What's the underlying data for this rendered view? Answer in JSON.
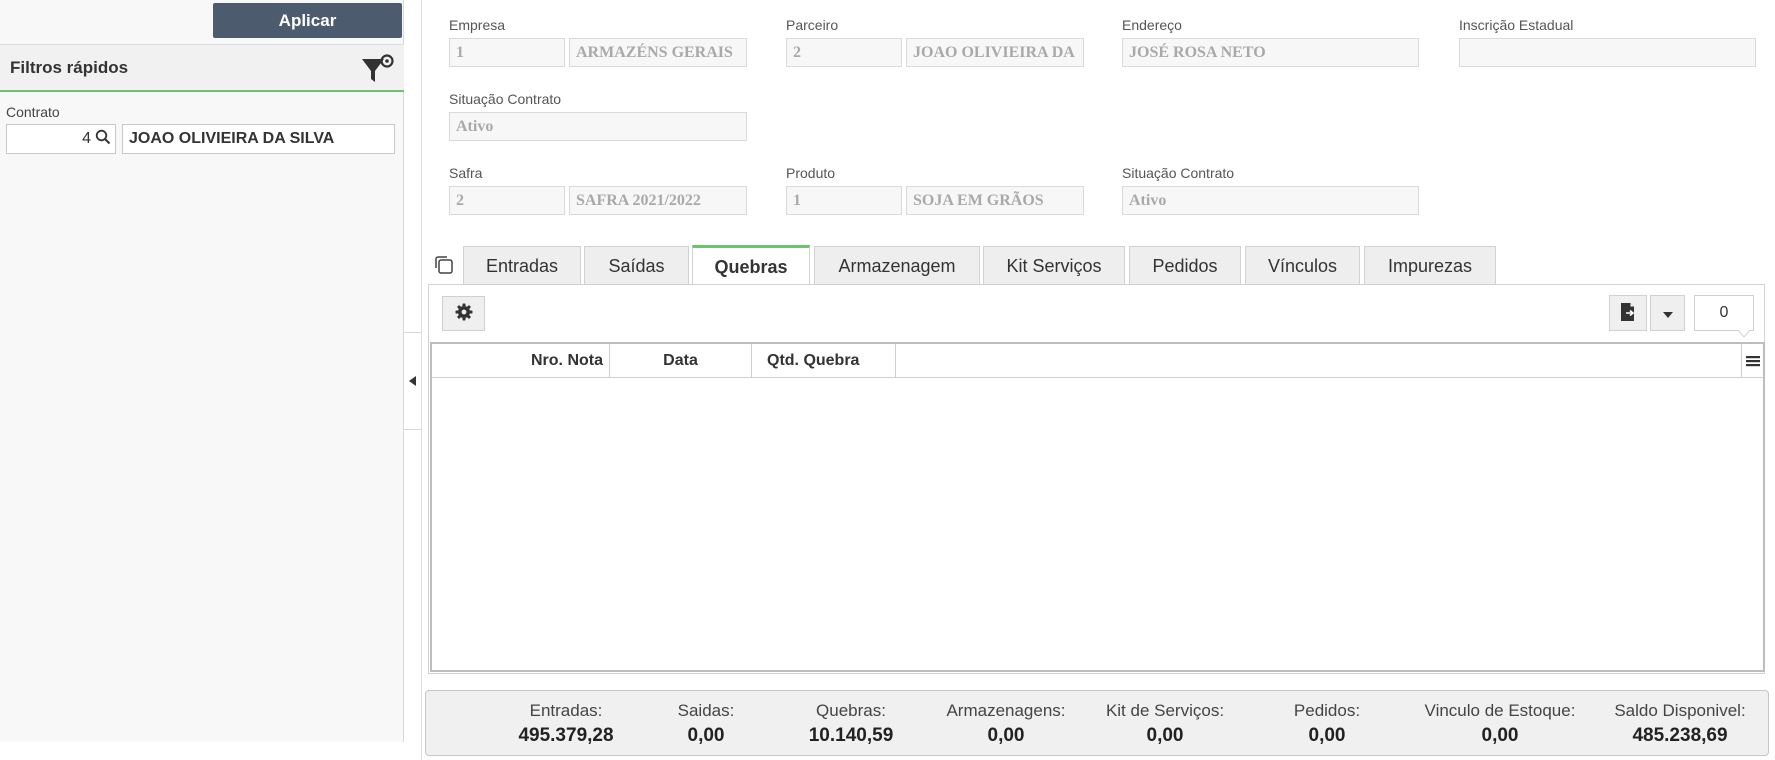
{
  "filters": {
    "apply_label": "Aplicar",
    "title": "Filtros rápidos",
    "contrato_label": "Contrato",
    "contrato_number": "4",
    "contrato_name": "JOAO OLIVIEIRA DA SILVA"
  },
  "form": {
    "empresa_label": "Empresa",
    "empresa_code": "1",
    "empresa_name": "ARMAZÉNS GERAIS",
    "parceiro_label": "Parceiro",
    "parceiro_code": "2",
    "parceiro_name": "JOAO OLIVIEIRA DA",
    "endereco_label": "Endereço",
    "endereco_value": "JOSÉ ROSA NETO",
    "inscricao_label": "Inscrição Estadual",
    "inscricao_value": "",
    "situacao1_label": "Situação Contrato",
    "situacao1_value": "Ativo",
    "safra_label": "Safra",
    "safra_code": "2",
    "safra_name": "SAFRA 2021/2022",
    "produto_label": "Produto",
    "produto_code": "1",
    "produto_name": "SOJA EM GRÃOS",
    "situacao2_label": "Situação Contrato",
    "situacao2_value": "Ativo"
  },
  "tabs": [
    {
      "label": "Entradas"
    },
    {
      "label": "Saídas"
    },
    {
      "label": "Quebras",
      "active": true
    },
    {
      "label": "Armazenagem"
    },
    {
      "label": "Kit Serviços"
    },
    {
      "label": "Pedidos"
    },
    {
      "label": "Vínculos"
    },
    {
      "label": "Impurezas"
    }
  ],
  "grid": {
    "record_count": "0",
    "columns": [
      "Nro. Nota",
      "Data",
      "Qtd. Quebra"
    ],
    "rows": []
  },
  "totals": [
    {
      "label": "Entradas:",
      "value": "495.379,28"
    },
    {
      "label": "Saidas:",
      "value": "0,00"
    },
    {
      "label": "Quebras:",
      "value": "10.140,59"
    },
    {
      "label": "Armazenagens:",
      "value": "0,00"
    },
    {
      "label": "Kit de Serviços:",
      "value": "0,00"
    },
    {
      "label": "Pedidos:",
      "value": "0,00"
    },
    {
      "label": "Vinculo de Estoque:",
      "value": "0,00"
    },
    {
      "label": "Saldo Disponivel:",
      "value": "485.238,69"
    }
  ],
  "colors": {
    "accent_green": "#6cc36c",
    "apply_button": "#4c5b6d"
  },
  "icons": [
    "filter-settings-icon",
    "search-icon",
    "collapse-arrow-icon",
    "copy-icon",
    "gear-icon",
    "export-icon",
    "caret-down-icon",
    "column-menu-icon"
  ]
}
